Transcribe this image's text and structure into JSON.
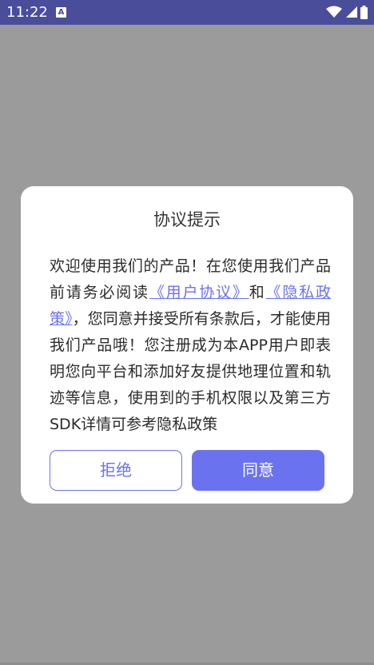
{
  "status_bar": {
    "time": "11:22",
    "notification_icon": "A",
    "icons": [
      "wifi-icon",
      "cellular-signal-icon",
      "battery-icon"
    ]
  },
  "dialog": {
    "title": "协议提示",
    "body_prefix": "欢迎使用我们的产品！在您使用我们产品前请务必阅读",
    "link_user_agreement": "《用户协议》",
    "connector": "和",
    "link_privacy_policy": "《隐私政策》",
    "body_suffix": "，您同意并接受所有条款后，才能使用我们产品哦！您注册成为本APP用户即表明您向平台和添加好友提供地理位置和轨迹等信息，使用到的手机权限以及第三方SDK详情可参考隐私政策",
    "reject_label": "拒绝",
    "agree_label": "同意"
  },
  "colors": {
    "status_bar": "#494d9a",
    "accent": "#6b72ef",
    "scrim": "#9b9b9b"
  }
}
